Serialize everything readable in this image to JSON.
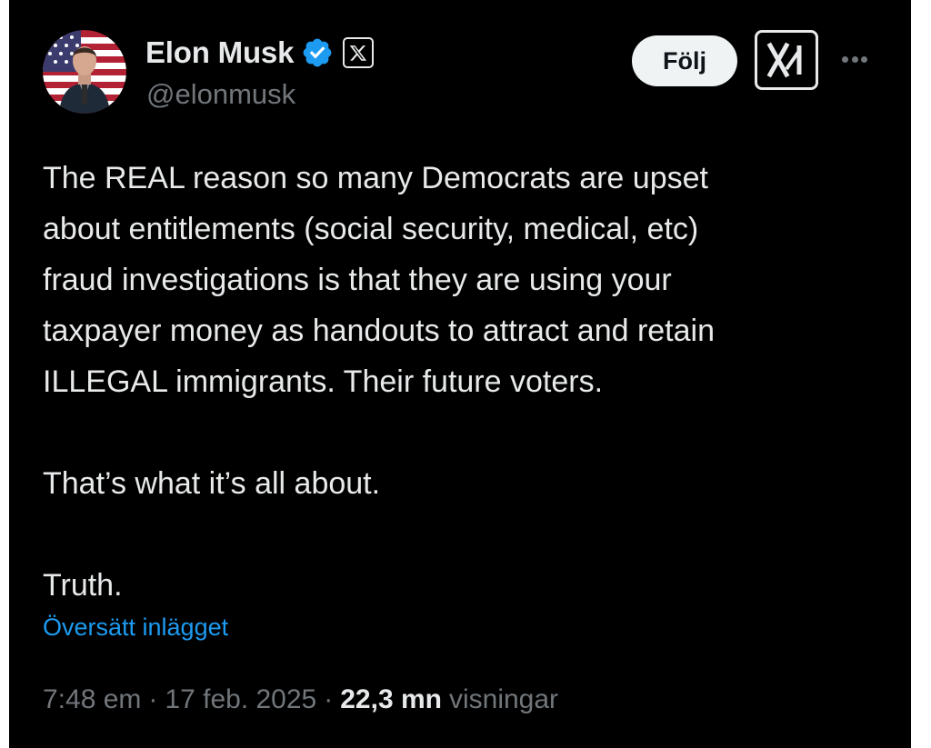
{
  "author": {
    "display_name": "Elon Musk",
    "handle": "@elonmusk",
    "verified_color": "#1d9bf0"
  },
  "actions": {
    "follow_label": "Följ",
    "grok_icon": "grok-icon",
    "more_icon": "more-options-icon"
  },
  "tweet": {
    "lines": [
      "The REAL reason so many Democrats are upset",
      "about entitlements (social security, medical, etc)",
      "fraud investigations is that they are using your",
      "taxpayer money as handouts to attract and retain",
      "ILLEGAL immigrants. Their future voters."
    ],
    "paragraph_2": "That’s what it’s all about.",
    "paragraph_3": "Truth.",
    "translate_label": "Översätt inlägget"
  },
  "meta": {
    "time": "7:48 em",
    "separator": "·",
    "date": "17 feb. 2025",
    "views_count": "22,3 mn",
    "views_label": "visningar"
  },
  "colors": {
    "background": "#000000",
    "text_primary": "#e7e9ea",
    "text_secondary": "#71767b",
    "link": "#1d9bf0"
  }
}
